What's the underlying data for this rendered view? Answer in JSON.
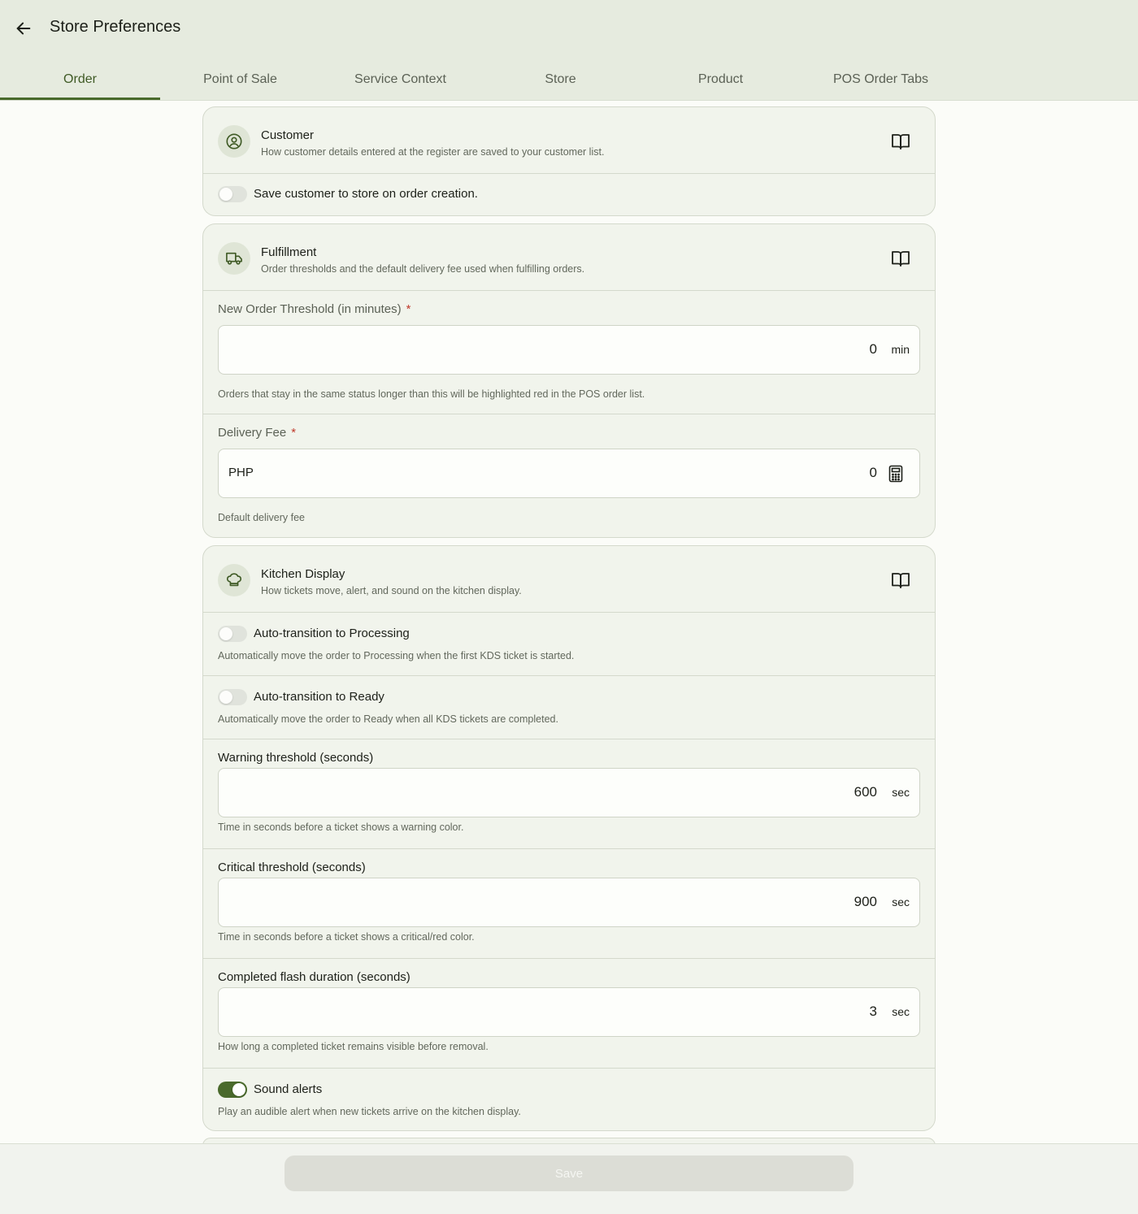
{
  "header": {
    "title": "Store Preferences",
    "tabs": [
      {
        "label": "Order",
        "active": true
      },
      {
        "label": "Point of Sale",
        "active": false
      },
      {
        "label": "Service Context",
        "active": false
      },
      {
        "label": "Store",
        "active": false
      },
      {
        "label": "Product",
        "active": false
      },
      {
        "label": "POS Order Tabs",
        "active": false
      }
    ]
  },
  "customer": {
    "icon": "user-circle-icon",
    "title": "Customer",
    "subtitle": "How customer details entered at the register are saved to your customer list.",
    "save_customer": {
      "label": "Save customer to store on order creation.",
      "enabled": false
    }
  },
  "fulfillment": {
    "icon": "truck-icon",
    "title": "Fulfillment",
    "subtitle": "Order thresholds and the default delivery fee used when fulfilling orders.",
    "new_order_threshold": {
      "label": "New Order Threshold (in minutes)",
      "required_mark": "*",
      "value": "0",
      "unit": "min",
      "helper": "Orders that stay in the same status longer than this will be highlighted red in the POS order list."
    },
    "delivery_fee": {
      "label": "Delivery Fee",
      "required_mark": "*",
      "currency": "PHP",
      "value": "0",
      "helper": "Default delivery fee"
    }
  },
  "kitchen": {
    "icon": "chef-hat-icon",
    "title": "Kitchen Display",
    "subtitle": "How tickets move, alert, and sound on the kitchen display.",
    "auto_processing": {
      "label": "Auto-transition to Processing",
      "helper": "Automatically move the order to Processing when the first KDS ticket is started.",
      "enabled": false
    },
    "auto_ready": {
      "label": "Auto-transition to Ready",
      "helper": "Automatically move the order to Ready when all KDS tickets are completed.",
      "enabled": false
    },
    "warning_threshold": {
      "label": "Warning threshold (seconds)",
      "value": "600",
      "unit": "sec",
      "helper": "Time in seconds before a ticket shows a warning color."
    },
    "critical_threshold": {
      "label": "Critical threshold (seconds)",
      "value": "900",
      "unit": "sec",
      "helper": "Time in seconds before a ticket shows a critical/red color."
    },
    "flash_duration": {
      "label": "Completed flash duration (seconds)",
      "value": "3",
      "unit": "sec",
      "helper": "How long a completed ticket remains visible before removal."
    },
    "sound_alerts": {
      "label": "Sound alerts",
      "helper": "Play an audible alert when new tickets arrive on the kitchen display.",
      "enabled": true
    }
  },
  "footer": {
    "save_label": "Save"
  },
  "colors": {
    "accent": "#4a6a2c",
    "header_bg": "#e6ebdf",
    "required": "#c0392b"
  }
}
